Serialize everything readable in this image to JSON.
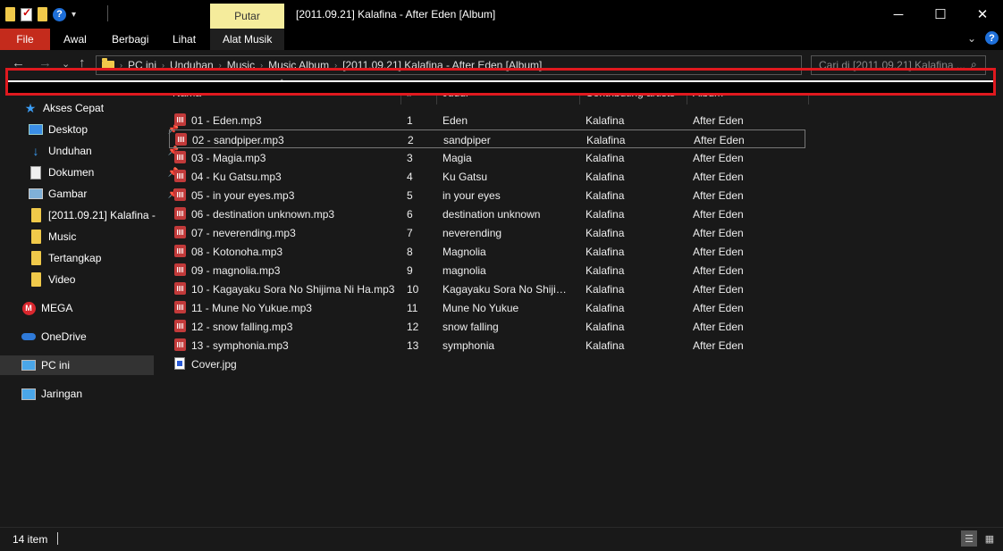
{
  "window": {
    "title": "[2011.09.21] Kalafina - After Eden [Album]",
    "minimize": "─",
    "maximize": "☐",
    "close": "✕"
  },
  "quick_access": {
    "help": "?",
    "dropdown": "▾"
  },
  "ribbon": {
    "contextual_group": "Putar",
    "tabs": [
      "File",
      "Awal",
      "Berbagi",
      "Lihat",
      "Alat Musik"
    ],
    "collapse": "⌄",
    "help": "?"
  },
  "nav_buttons": {
    "back": "←",
    "forward": "→",
    "recent": "⌄",
    "up": "↑"
  },
  "address": {
    "crumbs": [
      "PC ini",
      "Unduhan",
      "Music",
      "Music Album",
      "[2011.09.21] Kalafina - After Eden [Album]"
    ],
    "sep": "›"
  },
  "search": {
    "placeholder": "Cari di [2011.09.21] Kalafina ...",
    "icon": "⌕"
  },
  "columns": {
    "name": "Nama",
    "number": "#",
    "title": "Judul",
    "artist": "Contributing artists",
    "album": "Album",
    "sort_arrow": "^"
  },
  "nav_pane": {
    "quick_access": "Akses Cepat",
    "items": [
      "Desktop",
      "Unduhan",
      "Dokumen",
      "Gambar",
      "[2011.09.21] Kalafina -",
      "Music",
      "Tertangkap",
      "Video"
    ],
    "mega": "MEGA",
    "onedrive": "OneDrive",
    "pc": "PC ini",
    "network": "Jaringan",
    "pin": "📌"
  },
  "files": [
    {
      "name": "01 - Eden.mp3",
      "num": "1",
      "title": "Eden",
      "artist": "Kalafina",
      "album": "After Eden"
    },
    {
      "name": "02 - sandpiper.mp3",
      "num": "2",
      "title": "sandpiper",
      "artist": "Kalafina",
      "album": "After Eden"
    },
    {
      "name": "03 - Magia.mp3",
      "num": "3",
      "title": "Magia",
      "artist": "Kalafina",
      "album": "After Eden"
    },
    {
      "name": "04 - Ku Gatsu.mp3",
      "num": "4",
      "title": "Ku Gatsu",
      "artist": "Kalafina",
      "album": "After Eden"
    },
    {
      "name": "05 - in your eyes.mp3",
      "num": "5",
      "title": "in your eyes",
      "artist": "Kalafina",
      "album": "After Eden"
    },
    {
      "name": "06 - destination unknown.mp3",
      "num": "6",
      "title": "destination unknown",
      "artist": "Kalafina",
      "album": "After Eden"
    },
    {
      "name": "07 - neverending.mp3",
      "num": "7",
      "title": "neverending",
      "artist": "Kalafina",
      "album": "After Eden"
    },
    {
      "name": "08 - Kotonoha.mp3",
      "num": "8",
      "title": "Magnolia",
      "artist": "Kalafina",
      "album": "After Eden"
    },
    {
      "name": "09 - magnolia.mp3",
      "num": "9",
      "title": "magnolia",
      "artist": "Kalafina",
      "album": "After Eden"
    },
    {
      "name": "10 - Kagayaku Sora No Shijima Ni Ha.mp3",
      "num": "10",
      "title": "Kagayaku Sora No Shijim...",
      "artist": "Kalafina",
      "album": "After Eden"
    },
    {
      "name": "11 - Mune No Yukue.mp3",
      "num": "11",
      "title": "Mune No Yukue",
      "artist": "Kalafina",
      "album": "After Eden"
    },
    {
      "name": "12 - snow falling.mp3",
      "num": "12",
      "title": "snow falling",
      "artist": "Kalafina",
      "album": "After Eden"
    },
    {
      "name": "13 - symphonia.mp3",
      "num": "13",
      "title": "symphonia",
      "artist": "Kalafina",
      "album": "After Eden"
    },
    {
      "name": "Cover.jpg",
      "num": "",
      "title": "",
      "artist": "",
      "album": ""
    }
  ],
  "status": {
    "count": "14 item",
    "details_view": "☰",
    "tiles_view": "▦"
  },
  "colors": {
    "highlight": "#e0191f",
    "file_tab": "#c42b1c",
    "contextual_tab": "#f5ec9c",
    "accent": "#1e6fd9"
  }
}
